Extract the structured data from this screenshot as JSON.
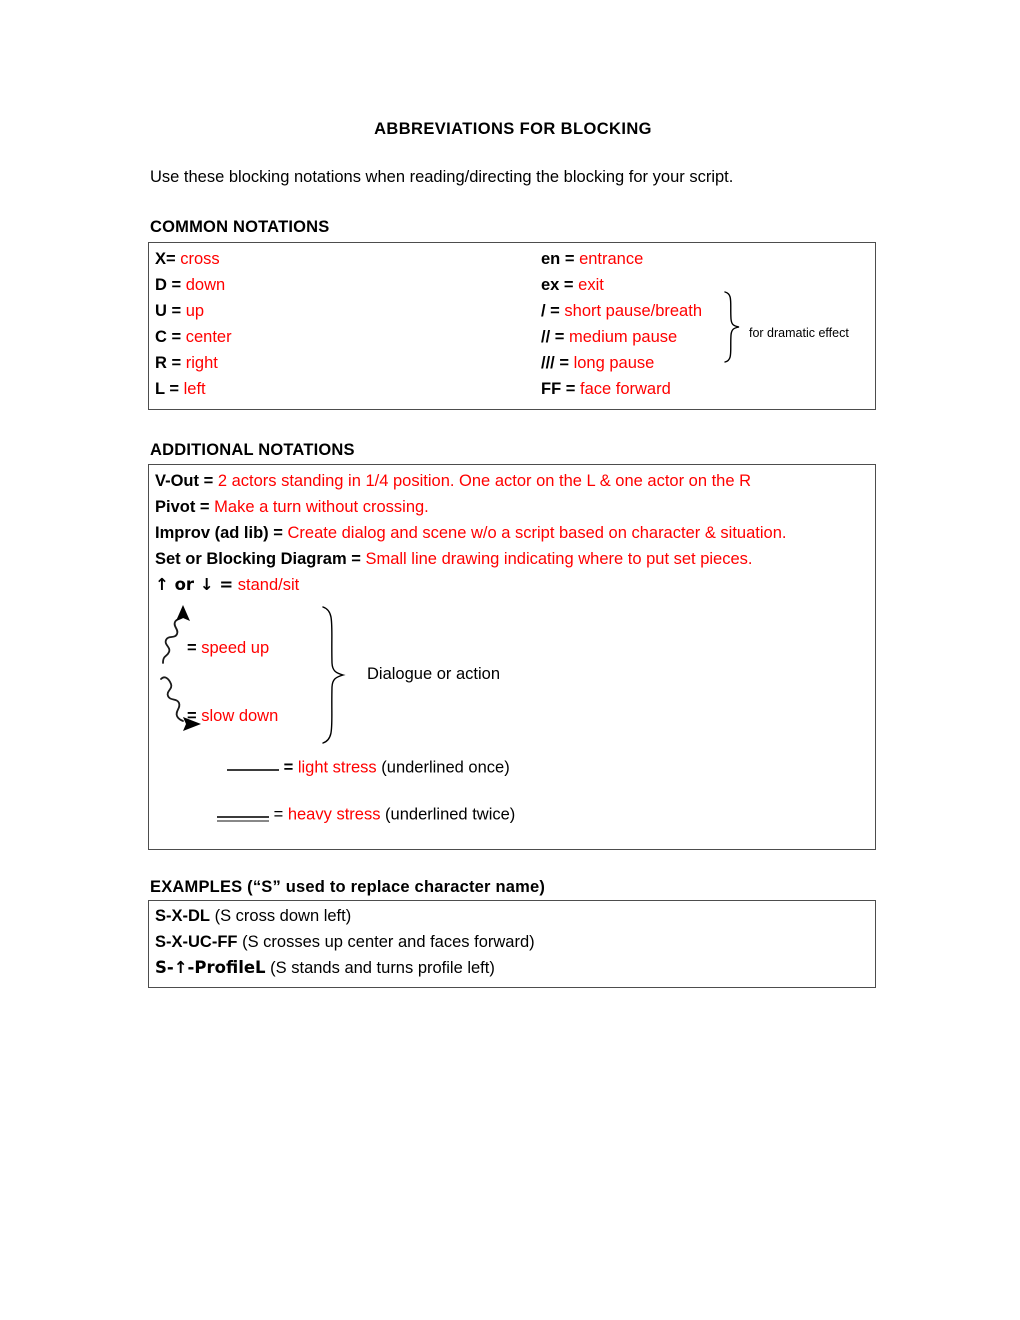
{
  "document": {
    "title": "ABBREVIATIONS FOR BLOCKING",
    "intro": "Use these blocking notations when reading/directing the blocking for your script."
  },
  "colors": {
    "definition_red": "#ff0000",
    "text_black": "#000000",
    "border_gray": "#4d4d4d"
  },
  "common_notations": {
    "heading": "COMMON NOTATIONS",
    "left_column": [
      {
        "key": "X=",
        "value": "cross"
      },
      {
        "key": "D =",
        "value": "down"
      },
      {
        "key": "U =",
        "value": "up"
      },
      {
        "key": "C =",
        "value": "center"
      },
      {
        "key": "R =",
        "value": "right"
      },
      {
        "key": "L =",
        "value": "left"
      }
    ],
    "right_column": [
      {
        "key": "en =",
        "value": "entrance"
      },
      {
        "key": "ex =",
        "value": "exit"
      },
      {
        "key": "/ =",
        "value": "short pause/breath"
      },
      {
        "key": "// =",
        "value": "medium pause"
      },
      {
        "key": "/// =",
        "value": "long pause"
      },
      {
        "key": "FF =",
        "value": "face forward"
      }
    ],
    "brace_annotation": "for dramatic effect"
  },
  "additional_notations": {
    "heading": "ADDITIONAL NOTATIONS",
    "rows": [
      {
        "key": "V-Out =",
        "value": "2 actors standing in 1/4 position. One actor on the L & one actor on the R"
      },
      {
        "key": "Pivot =",
        "value": "Make a turn without crossing."
      },
      {
        "key": "Improv (ad lib) =",
        "value": "Create dialog and scene w/o a script based on character & situation."
      },
      {
        "key": "Set or Blocking Diagram =",
        "value": "Small line drawing indicating where to put set pieces."
      },
      {
        "key": "↑ or ↓ =",
        "value": "stand/sit"
      }
    ],
    "diagram": {
      "speed_up": {
        "equals": "=",
        "label": "speed up",
        "icon": "wavy-up-arrow"
      },
      "slow_down": {
        "equals": "=",
        "label": "slow down",
        "icon": "wavy-right-arrow"
      },
      "brace_annotation": "Dialogue or action",
      "light_stress": {
        "equals": "=",
        "label": "light stress",
        "note": "(underlined once)",
        "underlines": 1
      },
      "heavy_stress": {
        "equals": "=",
        "label": "heavy stress",
        "note": "(underlined twice)",
        "underlines": 2
      }
    }
  },
  "examples": {
    "heading": "EXAMPLES (“S” used to replace character name)",
    "rows": [
      {
        "key": "S-X-DL",
        "note": "(S cross down left)"
      },
      {
        "key": "S-X-UC-FF",
        "note": "(S crosses up center and faces forward)"
      },
      {
        "key": "S-↑-ProfileL",
        "note": "(S stands and turns profile left)"
      }
    ]
  }
}
